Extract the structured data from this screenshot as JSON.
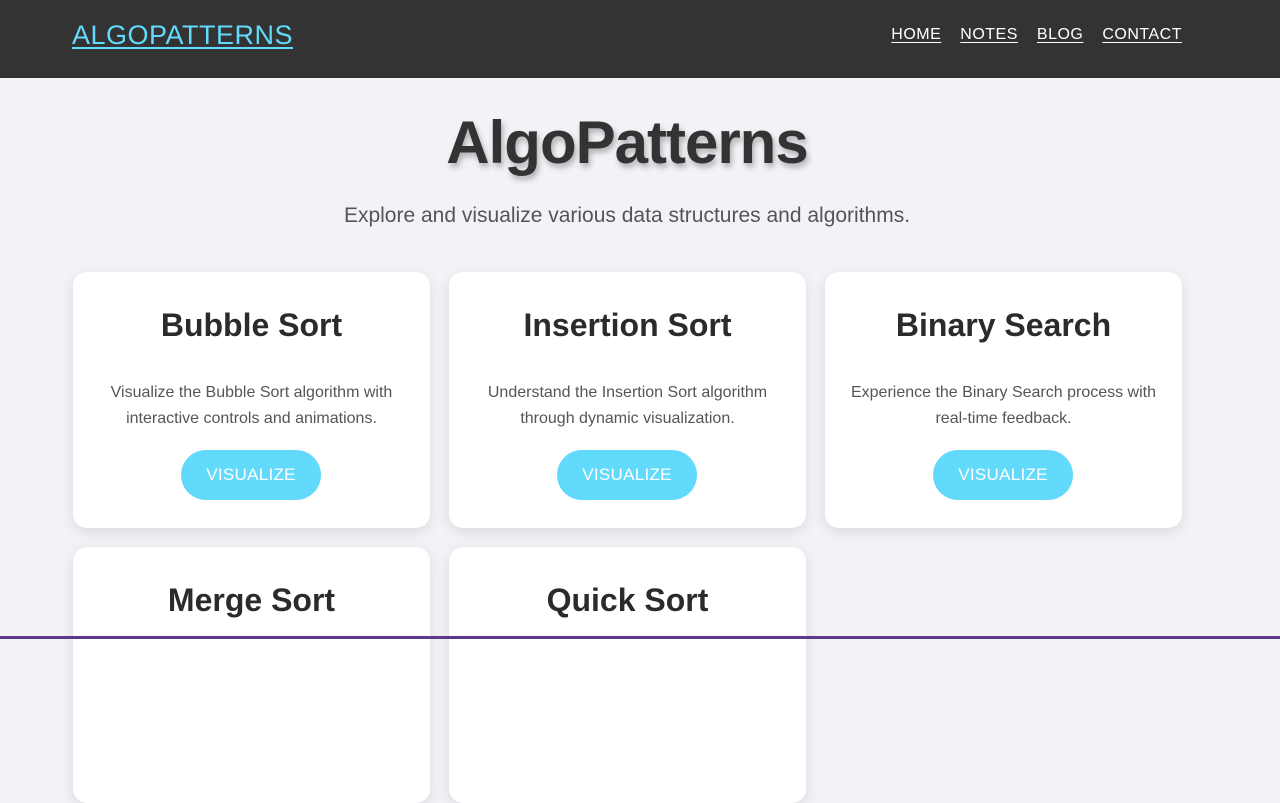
{
  "navbar": {
    "brand": "ALGOPATTERNS",
    "links": [
      "HOME",
      "NOTES",
      "BLOG",
      "CONTACT"
    ]
  },
  "hero": {
    "title": "AlgoPatterns",
    "subtitle": "Explore and visualize various data structures and algorithms."
  },
  "cards": [
    {
      "title": "Bubble Sort",
      "description": "Visualize the Bubble Sort algorithm with interactive controls and animations.",
      "button": "VISUALIZE"
    },
    {
      "title": "Insertion Sort",
      "description": "Understand the Insertion Sort algorithm through dynamic visualization.",
      "button": "VISUALIZE"
    },
    {
      "title": "Binary Search",
      "description": "Experience the Binary Search process with real-time feedback.",
      "button": "VISUALIZE"
    },
    {
      "title": "Merge Sort"
    },
    {
      "title": "Quick Sort"
    }
  ],
  "colors": {
    "accent": "#61dafb",
    "navbar_bg": "#333333",
    "page_bg": "#f3f2f7"
  }
}
